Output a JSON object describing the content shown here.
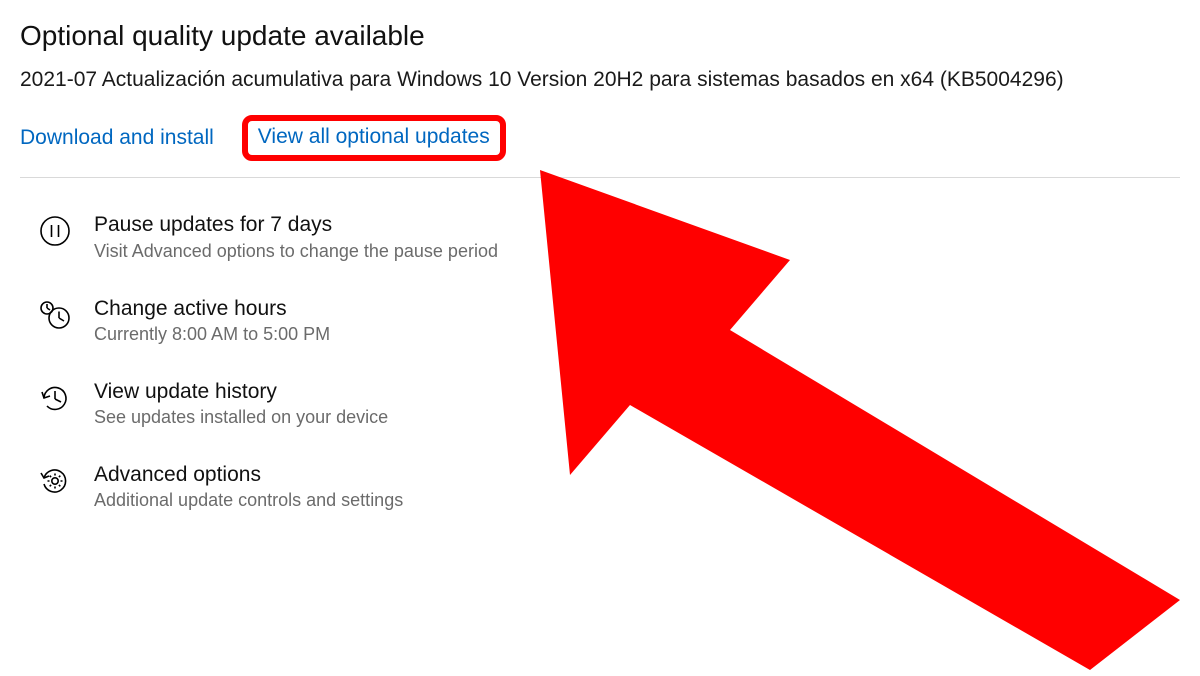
{
  "header": {
    "title": "Optional quality update available",
    "update_name": "2021-07 Actualización acumulativa para Windows 10 Version 20H2 para sistemas basados en x64 (KB5004296)"
  },
  "links": {
    "download_install": "Download and install",
    "view_all_optional": "View all optional updates"
  },
  "options": {
    "pause": {
      "label": "Pause updates for 7 days",
      "sub": "Visit Advanced options to change the pause period"
    },
    "active_hours": {
      "label": "Change active hours",
      "sub": "Currently 8:00 AM to 5:00 PM"
    },
    "history": {
      "label": "View update history",
      "sub": "See updates installed on your device"
    },
    "advanced": {
      "label": "Advanced options",
      "sub": "Additional update controls and settings"
    }
  },
  "annotation": {
    "arrow_color": "#ff0000"
  }
}
